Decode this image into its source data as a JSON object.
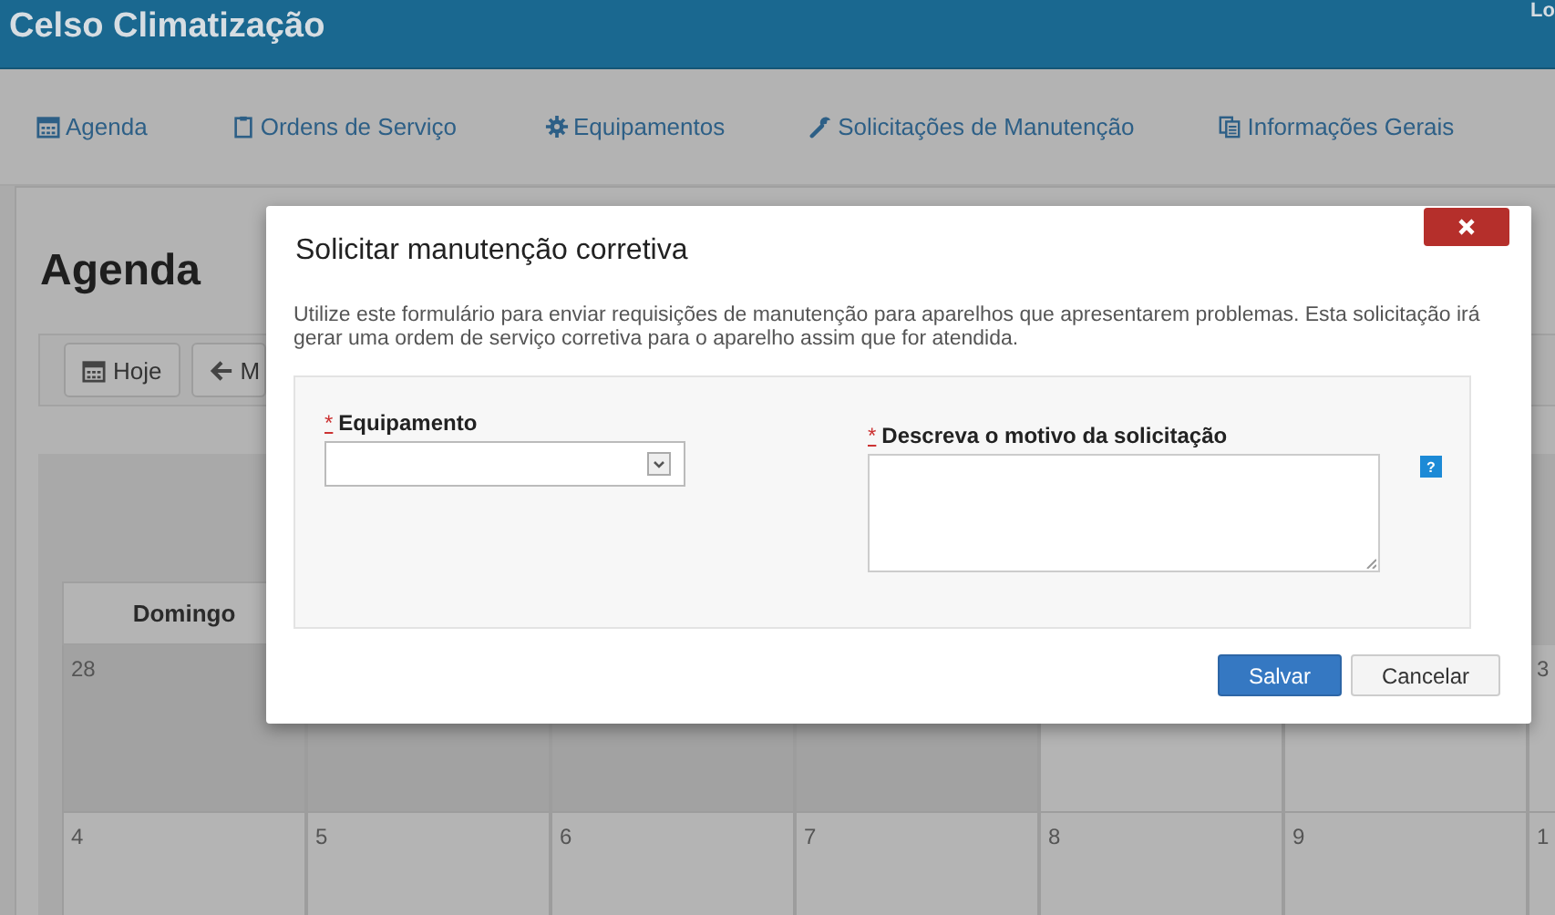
{
  "app": {
    "title": "Celso Climatização",
    "user_link": "Lo"
  },
  "nav": [
    {
      "label": "Agenda"
    },
    {
      "label": "Ordens de Serviço"
    },
    {
      "label": "Equipamentos"
    },
    {
      "label": "Solicitações de Manutenção"
    },
    {
      "label": "Informações Gerais"
    }
  ],
  "page": {
    "title": "Agenda",
    "toolbar": [
      {
        "label": "Hoje"
      },
      {
        "label": "M"
      }
    ]
  },
  "calendar": {
    "weekday_headers": [
      "Domingo"
    ],
    "weeks": [
      [
        {
          "day": "28",
          "muted": true
        },
        {
          "muted": true
        },
        {
          "muted": true
        },
        {
          "muted": true
        },
        {
          "muted": false
        },
        {
          "muted": false
        },
        {
          "day": "3",
          "muted": false
        }
      ],
      [
        {
          "day": "4",
          "muted": false
        },
        {
          "day": "5",
          "muted": false
        },
        {
          "day": "6",
          "muted": false
        },
        {
          "day": "7",
          "muted": false
        },
        {
          "day": "8",
          "muted": false
        },
        {
          "day": "9",
          "muted": false
        },
        {
          "day": "1",
          "muted": false
        }
      ]
    ]
  },
  "modal": {
    "title": "Solicitar manutenção corretiva",
    "description": "Utilize este formulário para enviar requisições de manutenção para aparelhos que apresentarem problemas. Esta solicitação irá gerar uma ordem de serviço corretiva para o aparelho assim que for atendida.",
    "fields": [
      {
        "kind": "select",
        "label": "Equipamento",
        "required_mark": "*"
      },
      {
        "kind": "textarea",
        "label": "Descreva o motivo da solicitação",
        "required_mark": "*",
        "help": "?"
      }
    ],
    "buttons": [
      {
        "label": "Salvar",
        "primary": true
      },
      {
        "label": "Cancelar",
        "primary": false
      }
    ]
  }
}
